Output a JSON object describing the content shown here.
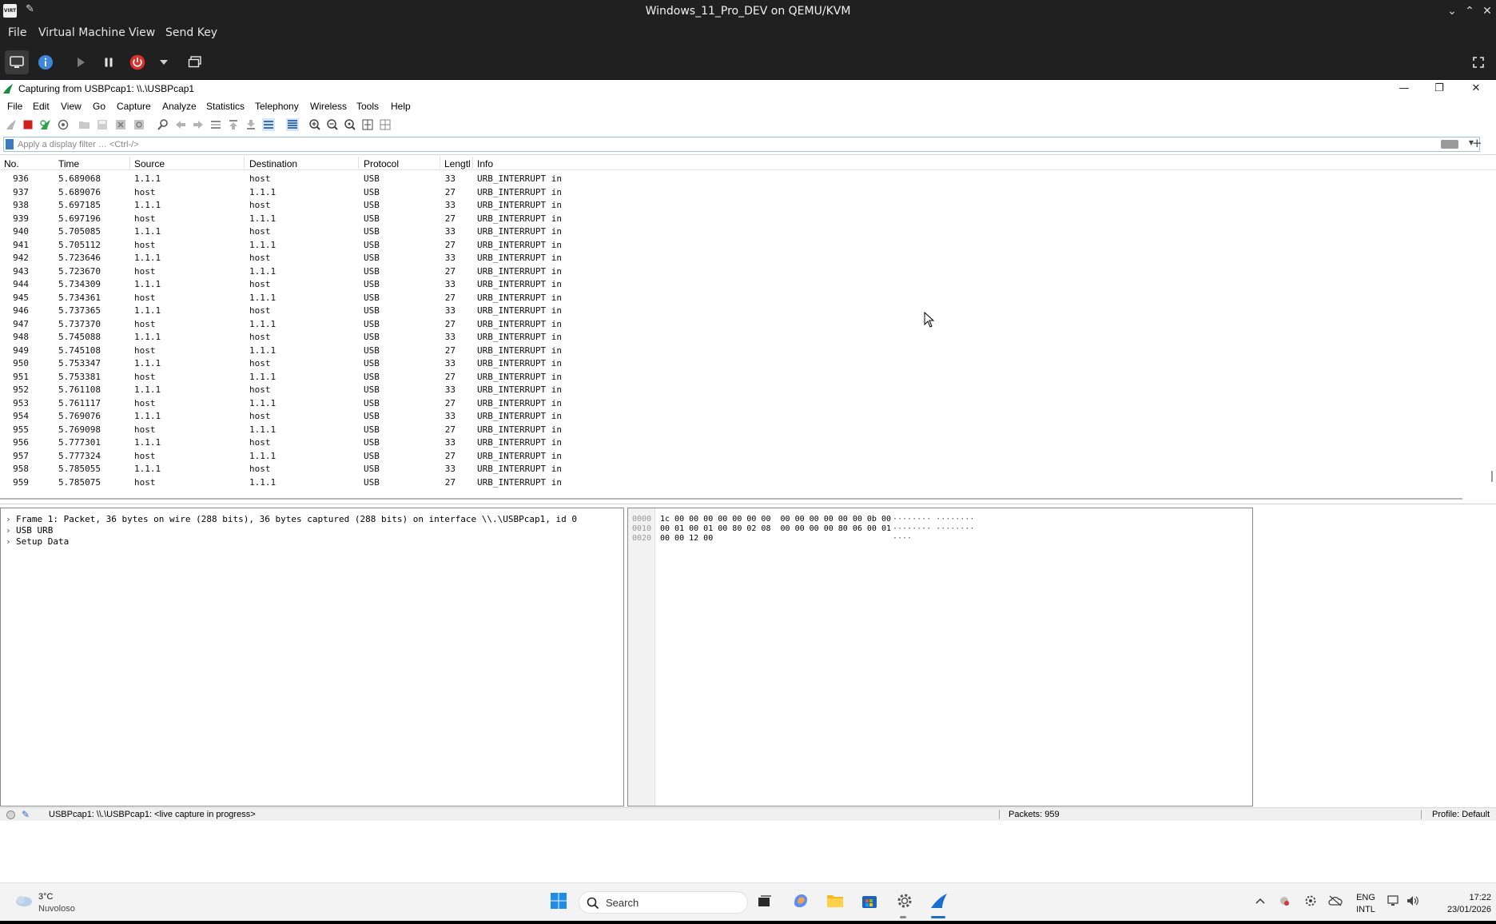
{
  "vm": {
    "title": "Windows_11_Pro_DEV on QEMU/KVM",
    "app_icon_text": "VIRT",
    "menu": [
      "File",
      "Virtual Machine",
      "View",
      "Send Key"
    ]
  },
  "wireshark": {
    "title": "Capturing from USBPcap1: \\\\.\\USBPcap1",
    "menu": [
      "File",
      "Edit",
      "View",
      "Go",
      "Capture",
      "Analyze",
      "Statistics",
      "Telephony",
      "Wireless",
      "Tools",
      "Help"
    ],
    "filter_placeholder": "Apply a display filter … <Ctrl-/>",
    "columns": [
      "No.",
      "Time",
      "Source",
      "Destination",
      "Protocol",
      "Lengtl",
      "Info"
    ],
    "packets": [
      {
        "no": "936",
        "time": "5.689068",
        "src": "1.1.1",
        "dst": "host",
        "proto": "USB",
        "len": "33",
        "info": "URB_INTERRUPT in"
      },
      {
        "no": "937",
        "time": "5.689076",
        "src": "host",
        "dst": "1.1.1",
        "proto": "USB",
        "len": "27",
        "info": "URB_INTERRUPT in"
      },
      {
        "no": "938",
        "time": "5.697185",
        "src": "1.1.1",
        "dst": "host",
        "proto": "USB",
        "len": "33",
        "info": "URB_INTERRUPT in"
      },
      {
        "no": "939",
        "time": "5.697196",
        "src": "host",
        "dst": "1.1.1",
        "proto": "USB",
        "len": "27",
        "info": "URB_INTERRUPT in"
      },
      {
        "no": "940",
        "time": "5.705085",
        "src": "1.1.1",
        "dst": "host",
        "proto": "USB",
        "len": "33",
        "info": "URB_INTERRUPT in"
      },
      {
        "no": "941",
        "time": "5.705112",
        "src": "host",
        "dst": "1.1.1",
        "proto": "USB",
        "len": "27",
        "info": "URB_INTERRUPT in"
      },
      {
        "no": "942",
        "time": "5.723646",
        "src": "1.1.1",
        "dst": "host",
        "proto": "USB",
        "len": "33",
        "info": "URB_INTERRUPT in"
      },
      {
        "no": "943",
        "time": "5.723670",
        "src": "host",
        "dst": "1.1.1",
        "proto": "USB",
        "len": "27",
        "info": "URB_INTERRUPT in"
      },
      {
        "no": "944",
        "time": "5.734309",
        "src": "1.1.1",
        "dst": "host",
        "proto": "USB",
        "len": "33",
        "info": "URB_INTERRUPT in"
      },
      {
        "no": "945",
        "time": "5.734361",
        "src": "host",
        "dst": "1.1.1",
        "proto": "USB",
        "len": "27",
        "info": "URB_INTERRUPT in"
      },
      {
        "no": "946",
        "time": "5.737365",
        "src": "1.1.1",
        "dst": "host",
        "proto": "USB",
        "len": "33",
        "info": "URB_INTERRUPT in"
      },
      {
        "no": "947",
        "time": "5.737370",
        "src": "host",
        "dst": "1.1.1",
        "proto": "USB",
        "len": "27",
        "info": "URB_INTERRUPT in"
      },
      {
        "no": "948",
        "time": "5.745088",
        "src": "1.1.1",
        "dst": "host",
        "proto": "USB",
        "len": "33",
        "info": "URB_INTERRUPT in"
      },
      {
        "no": "949",
        "time": "5.745108",
        "src": "host",
        "dst": "1.1.1",
        "proto": "USB",
        "len": "27",
        "info": "URB_INTERRUPT in"
      },
      {
        "no": "950",
        "time": "5.753347",
        "src": "1.1.1",
        "dst": "host",
        "proto": "USB",
        "len": "33",
        "info": "URB_INTERRUPT in"
      },
      {
        "no": "951",
        "time": "5.753381",
        "src": "host",
        "dst": "1.1.1",
        "proto": "USB",
        "len": "27",
        "info": "URB_INTERRUPT in"
      },
      {
        "no": "952",
        "time": "5.761108",
        "src": "1.1.1",
        "dst": "host",
        "proto": "USB",
        "len": "33",
        "info": "URB_INTERRUPT in"
      },
      {
        "no": "953",
        "time": "5.761117",
        "src": "host",
        "dst": "1.1.1",
        "proto": "USB",
        "len": "27",
        "info": "URB_INTERRUPT in"
      },
      {
        "no": "954",
        "time": "5.769076",
        "src": "1.1.1",
        "dst": "host",
        "proto": "USB",
        "len": "33",
        "info": "URB_INTERRUPT in"
      },
      {
        "no": "955",
        "time": "5.769098",
        "src": "host",
        "dst": "1.1.1",
        "proto": "USB",
        "len": "27",
        "info": "URB_INTERRUPT in"
      },
      {
        "no": "956",
        "time": "5.777301",
        "src": "1.1.1",
        "dst": "host",
        "proto": "USB",
        "len": "33",
        "info": "URB_INTERRUPT in"
      },
      {
        "no": "957",
        "time": "5.777324",
        "src": "host",
        "dst": "1.1.1",
        "proto": "USB",
        "len": "27",
        "info": "URB_INTERRUPT in"
      },
      {
        "no": "958",
        "time": "5.785055",
        "src": "1.1.1",
        "dst": "host",
        "proto": "USB",
        "len": "33",
        "info": "URB_INTERRUPT in"
      },
      {
        "no": "959",
        "time": "5.785075",
        "src": "host",
        "dst": "1.1.1",
        "proto": "USB",
        "len": "27",
        "info": "URB_INTERRUPT in"
      }
    ],
    "details": [
      "Frame 1: Packet, 36 bytes on wire (288 bits), 36 bytes captured (288 bits) on interface \\\\.\\USBPcap1, id 0",
      "USB URB",
      "Setup Data"
    ],
    "bytes": [
      {
        "offset": "0000",
        "hex": "1c 00 00 00 00 00 00 00  00 00 00 00 00 00 0b 00",
        "ascii": "········ ········"
      },
      {
        "offset": "0010",
        "hex": "00 01 00 01 00 80 02 08  00 00 00 00 80 06 00 01",
        "ascii": "········ ········"
      },
      {
        "offset": "0020",
        "hex": "00 00 12 00",
        "ascii": "····"
      }
    ],
    "status": {
      "capture": "USBPcap1: \\\\.\\USBPcap1: <live capture in progress>",
      "packets": "Packets: 959",
      "profile": "Profile: Default"
    }
  },
  "taskbar": {
    "weather_temp": "3°C",
    "weather_condition": "Nuvoloso",
    "search_label": "Search",
    "lang_top": "ENG",
    "lang_bottom": "INTL",
    "time": "17:22",
    "date": "23/01/2026"
  },
  "colors": {
    "vm_chrome": "#202020",
    "accent_blue": "#2f6db5",
    "stop_red": "#d11f1f",
    "taskbar_bg": "#f3f3f3"
  }
}
